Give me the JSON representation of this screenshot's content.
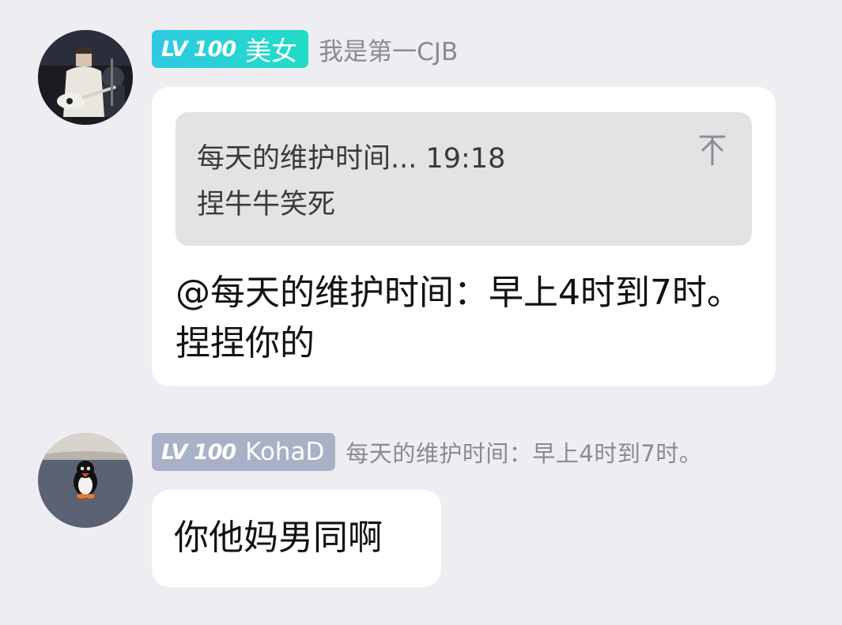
{
  "messages": [
    {
      "avatar_icon": "avatar-guitarist-photo-icon",
      "level": "LV 100",
      "badge_name": "美女",
      "badge_color": "#22d3d3",
      "title": "我是第一CJB",
      "reply_quote": {
        "header": "每天的维护时间... 19:18",
        "body": "捏牛牛笑死",
        "jump_icon": "scroll-to-original-icon"
      },
      "text": "@每天的维护时间：早上4时到7时。 捏捏你的"
    },
    {
      "avatar_icon": "avatar-penguin-photo-icon",
      "level": "LV 100",
      "badge_name": "KohaD",
      "badge_color": "#a9b1c6",
      "title": "每天的维护时间：早上4时到7时。",
      "text": "你他妈男同啊"
    }
  ]
}
